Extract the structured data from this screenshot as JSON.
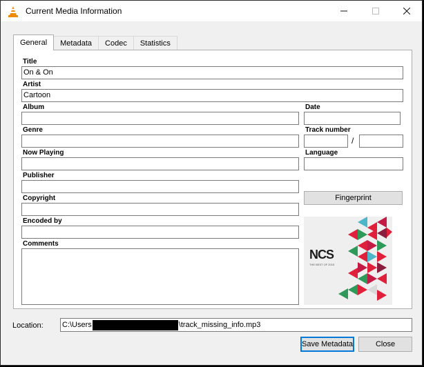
{
  "window": {
    "title": "Current Media Information"
  },
  "tabs": [
    "General",
    "Metadata",
    "Codec",
    "Statistics"
  ],
  "fields": {
    "title": {
      "label": "Title",
      "value": "On & On"
    },
    "artist": {
      "label": "Artist",
      "value": "Cartoon"
    },
    "album": {
      "label": "Album",
      "value": ""
    },
    "date": {
      "label": "Date",
      "value": ""
    },
    "genre": {
      "label": "Genre",
      "value": ""
    },
    "track_number": {
      "label": "Track number",
      "value": "",
      "total": "",
      "separator": "/"
    },
    "now_playing": {
      "label": "Now Playing",
      "value": ""
    },
    "language": {
      "label": "Language",
      "value": ""
    },
    "publisher": {
      "label": "Publisher",
      "value": ""
    },
    "copyright": {
      "label": "Copyright",
      "value": ""
    },
    "encoded_by": {
      "label": "Encoded by",
      "value": ""
    },
    "comments": {
      "label": "Comments",
      "value": ""
    }
  },
  "buttons": {
    "fingerprint": "Fingerprint",
    "save_metadata": "Save Metadata",
    "close": "Close"
  },
  "cover": {
    "logo_text": "NCS",
    "sub_text": "THE BEST OF 2015"
  },
  "location": {
    "label": "Location:",
    "prefix": "C:\\Users",
    "suffix": "\\track_missing_info.mp3"
  },
  "colors": {
    "accent": "#0078d7",
    "cover_red": "#e0203a",
    "cover_green": "#2e9a5a",
    "cover_dark": "#2b2b2b"
  }
}
